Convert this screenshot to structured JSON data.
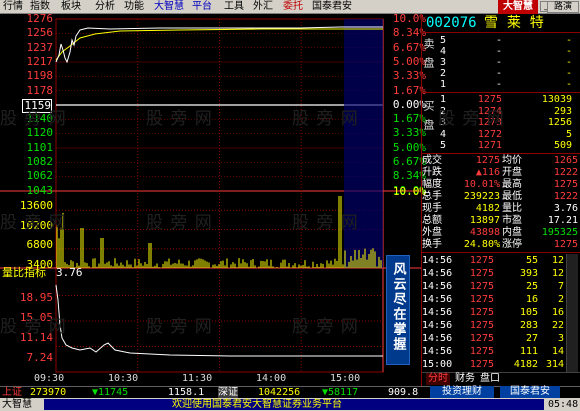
{
  "menu": {
    "items": [
      "行情",
      "指数",
      "板块",
      "分析",
      "功能",
      "大智慧",
      "平台",
      "工具",
      "外汇",
      "委托",
      "国泰君安"
    ],
    "logo": "大智慧",
    "ctl_min": "_",
    "ctl_max": "□",
    "ctl_close": "×"
  },
  "chart": {
    "price_labels": [
      "1276",
      "1256",
      "1237",
      "1217",
      "1198",
      "1178",
      "1159",
      "1140",
      "1120",
      "1101",
      "1082",
      "1062",
      "1043"
    ],
    "pct_labels": [
      "10.0%",
      "8.34%",
      "6.67%",
      "5.00%",
      "3.33%",
      "1.67%",
      "0.00%",
      "1.67%",
      "3.33%",
      "5.00%",
      "6.67%",
      "8.34%",
      "10.0%"
    ],
    "vol_labels": [
      "13600",
      "10200",
      "6800",
      "3400"
    ],
    "vol_pct": "10.0%",
    "indicator_name": "量比指标",
    "indicator_value": "3.76",
    "ind_labels": [
      "18.95",
      "15.05",
      "11.14",
      "7.24"
    ],
    "time_labels": [
      "09:30",
      "10:30",
      "11:30",
      "14:00",
      "15:00"
    ],
    "side_tab": "风云尽在掌握"
  },
  "stock": {
    "code": "002076",
    "name": "雪  莱  特",
    "sell_label": "卖盘",
    "buy_label": "买盘",
    "sell": [
      [
        "5",
        "-",
        "-"
      ],
      [
        "4",
        "-",
        "-"
      ],
      [
        "3",
        "-",
        "-"
      ],
      [
        "2",
        "-",
        "-"
      ],
      [
        "1",
        "-",
        "-"
      ]
    ],
    "buy": [
      [
        "1",
        "1275",
        "13039"
      ],
      [
        "2",
        "1274",
        "293"
      ],
      [
        "3",
        "1273",
        "1256"
      ],
      [
        "4",
        "1272",
        "5"
      ],
      [
        "5",
        "1271",
        "509"
      ]
    ],
    "info": [
      [
        "成交",
        "1275",
        "均价",
        "1265"
      ],
      [
        "升跌",
        "▲116",
        "开盘",
        "1222"
      ],
      [
        "幅度",
        "10.01%",
        "最高",
        "1275"
      ],
      [
        "总手",
        "239223",
        "最低",
        "1222"
      ],
      [
        "现手",
        "4182",
        "量比",
        "3.76"
      ],
      [
        "总额",
        "13897",
        "市盈",
        "17.21"
      ],
      [
        "外盘",
        "43898",
        "内盘",
        "195325"
      ],
      [
        "换手",
        "24.80%",
        "涨停",
        "1275"
      ]
    ],
    "ticks": [
      [
        "14:56",
        "1275",
        "55",
        "12"
      ],
      [
        "14:56",
        "1275",
        "393",
        "12"
      ],
      [
        "14:56",
        "1275",
        "25",
        "7"
      ],
      [
        "14:56",
        "1275",
        "16",
        "2"
      ],
      [
        "14:56",
        "1275",
        "105",
        "16"
      ],
      [
        "14:56",
        "1275",
        "283",
        "22"
      ],
      [
        "14:56",
        "1275",
        "27",
        "3"
      ],
      [
        "14:56",
        "1275",
        "111",
        "14"
      ],
      [
        "15:00",
        "1275",
        "4182",
        "314"
      ]
    ],
    "tabs": [
      "分时",
      "财务",
      "盘口"
    ],
    "mode_label": "路演"
  },
  "status": {
    "sh_label": "上证",
    "sh_value": "273970",
    "sh_change": "▼11745",
    "sh_index": "1158.1",
    "sz_label": "深证",
    "sz_value": "1042256",
    "sz_change": "▼58117",
    "sz_index": "909.8",
    "tab1": "投资理财",
    "tab2": "国泰君安",
    "app_name": "大智慧",
    "ticker": "欢迎使用国泰君安大智慧证券业务平台",
    "clock": "05:48"
  },
  "watermark": "股 旁 网",
  "colors": {
    "up": "#ff3c3c",
    "down": "#00e000",
    "flat": "#ffffff",
    "accent": "#ffff00",
    "grid": "#8b0000"
  }
}
